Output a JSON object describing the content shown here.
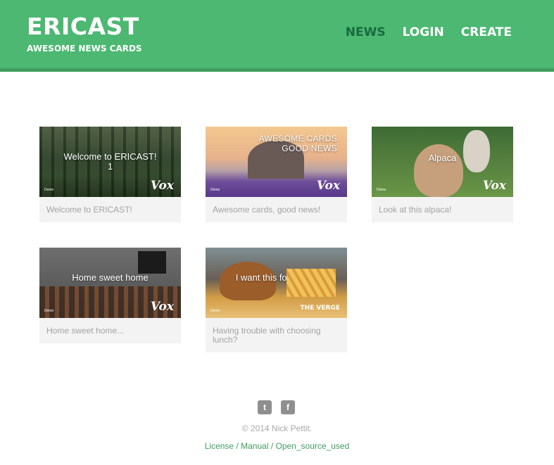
{
  "header": {
    "logo": "ERICAST",
    "tagline": "AWESOME NEWS CARDS",
    "nav": [
      {
        "label": "NEWS"
      },
      {
        "label": "LOGIN"
      },
      {
        "label": "CREATE"
      }
    ]
  },
  "cards": [
    {
      "overlay": "Welcome to ERICAST!\n1",
      "brand": "Vox",
      "demo": "Demo",
      "caption": "Welcome to ERICAST!"
    },
    {
      "overlay": "AWESOME CARDS\nGOOD NEWS",
      "brand": "Vox",
      "demo": "Demo",
      "caption": "Awesome cards, good news!"
    },
    {
      "overlay": "Alpaca",
      "brand": "Vox",
      "demo": "Demo",
      "caption": "Look at this alpaca!"
    },
    {
      "overlay": "Home sweet home",
      "brand": "Vox",
      "demo": "Demo",
      "caption": "Home sweet home..."
    },
    {
      "overlay": "I want this for lunch!",
      "brand": "THE VERGE",
      "demo": "Demo",
      "caption": "Having trouble with choosing lunch?"
    }
  ],
  "footer": {
    "social": [
      {
        "icon": "twitter-icon",
        "glyph": "t"
      },
      {
        "icon": "facebook-icon",
        "glyph": "f"
      }
    ],
    "copyright": "© 2014 Nick Pettit.",
    "links": [
      {
        "label": "License"
      },
      {
        "label": "Manual"
      },
      {
        "label": "Open_source_used"
      }
    ],
    "separator": " / "
  },
  "colors": {
    "header_bg": "#4cb872",
    "nav_active": "#176b40",
    "link": "#3f9d60"
  }
}
